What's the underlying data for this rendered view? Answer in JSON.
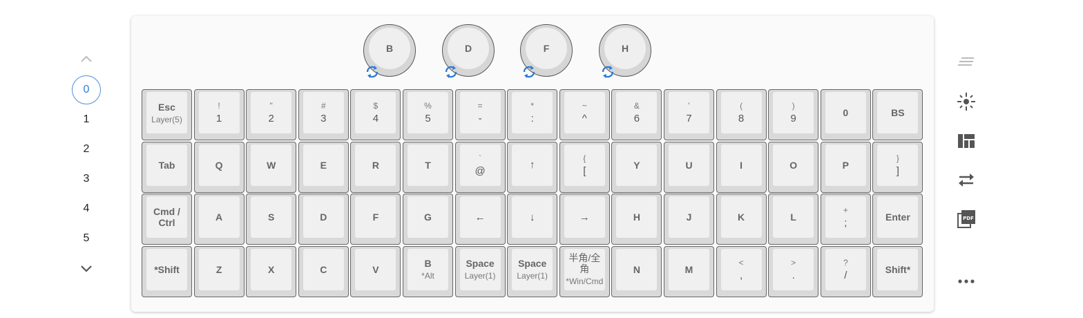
{
  "layers": {
    "items": [
      "0",
      "1",
      "2",
      "3",
      "4",
      "5"
    ],
    "selected": "0"
  },
  "encoders": [
    "B",
    "D",
    "F",
    "H"
  ],
  "rows": [
    [
      {
        "main": "Esc",
        "sub": "Layer(5)"
      },
      {
        "top": "!",
        "sym": "1"
      },
      {
        "top": "\"",
        "sym": "2"
      },
      {
        "top": "#",
        "sym": "3"
      },
      {
        "top": "$",
        "sym": "4"
      },
      {
        "top": "%",
        "sym": "5"
      },
      {
        "top": "=",
        "sym": "-"
      },
      {
        "top": "*",
        "sym": ":"
      },
      {
        "top": "~",
        "sym": "^"
      },
      {
        "top": "&",
        "sym": "6"
      },
      {
        "top": "'",
        "sym": "7"
      },
      {
        "top": "(",
        "sym": "8"
      },
      {
        "top": ")",
        "sym": "9"
      },
      {
        "main": "0"
      },
      {
        "main": "BS"
      }
    ],
    [
      {
        "main": "Tab"
      },
      {
        "main": "Q"
      },
      {
        "main": "W"
      },
      {
        "main": "E"
      },
      {
        "main": "R"
      },
      {
        "main": "T"
      },
      {
        "top": "`",
        "sym": "@"
      },
      {
        "sym": "↑"
      },
      {
        "top": "{",
        "sym": "["
      },
      {
        "main": "Y"
      },
      {
        "main": "U"
      },
      {
        "main": "I"
      },
      {
        "main": "O"
      },
      {
        "main": "P"
      },
      {
        "top": "}",
        "sym": "]"
      }
    ],
    [
      {
        "main": "Cmd /",
        "main2": "Ctrl"
      },
      {
        "main": "A"
      },
      {
        "main": "S"
      },
      {
        "main": "D"
      },
      {
        "main": "F"
      },
      {
        "main": "G"
      },
      {
        "sym": "←"
      },
      {
        "sym": "↓"
      },
      {
        "sym": "→"
      },
      {
        "main": "H"
      },
      {
        "main": "J"
      },
      {
        "main": "K"
      },
      {
        "main": "L"
      },
      {
        "top": "+",
        "sym": ";"
      },
      {
        "main": "Enter"
      }
    ],
    [
      {
        "main": "*Shift"
      },
      {
        "main": "Z"
      },
      {
        "main": "X"
      },
      {
        "main": "C"
      },
      {
        "main": "V"
      },
      {
        "main": "B",
        "sub": "*Alt"
      },
      {
        "main": "Space",
        "sub": "Layer(1)"
      },
      {
        "main": "Space",
        "sub": "Layer(1)"
      },
      {
        "cjk": "半角/全角",
        "sub": "*Win/Cmd"
      },
      {
        "main": "N"
      },
      {
        "main": "M"
      },
      {
        "top": "<",
        "sym": ","
      },
      {
        "top": ">",
        "sym": "."
      },
      {
        "top": "?",
        "sym": "/"
      },
      {
        "main": "Shift*"
      }
    ]
  ],
  "toolbar": [
    "notes-icon",
    "brightness-icon",
    "layout-icon",
    "swap-icon",
    "pdf-icon",
    "more-icon"
  ],
  "colors": {
    "accent": "#2a7bd6",
    "key_body": "#d9d9d9",
    "key_cap": "#f0f0f0"
  }
}
